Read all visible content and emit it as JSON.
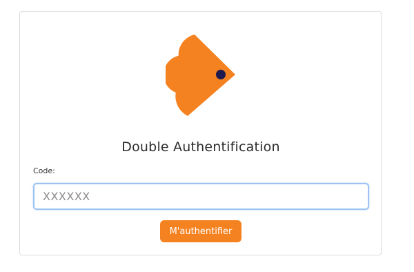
{
  "login": {
    "title": "Double Authentification",
    "code_label": "Code:",
    "code_placeholder": "XXXXXX",
    "code_value": "",
    "submit_label": "M'authentifier"
  },
  "logo": {
    "icon": "fish-logo-icon",
    "primary_color": "#f58220",
    "eye_color": "#1c1a4e"
  },
  "colors": {
    "accent": "#f58220",
    "input_focus_border": "#9cc3f2"
  }
}
